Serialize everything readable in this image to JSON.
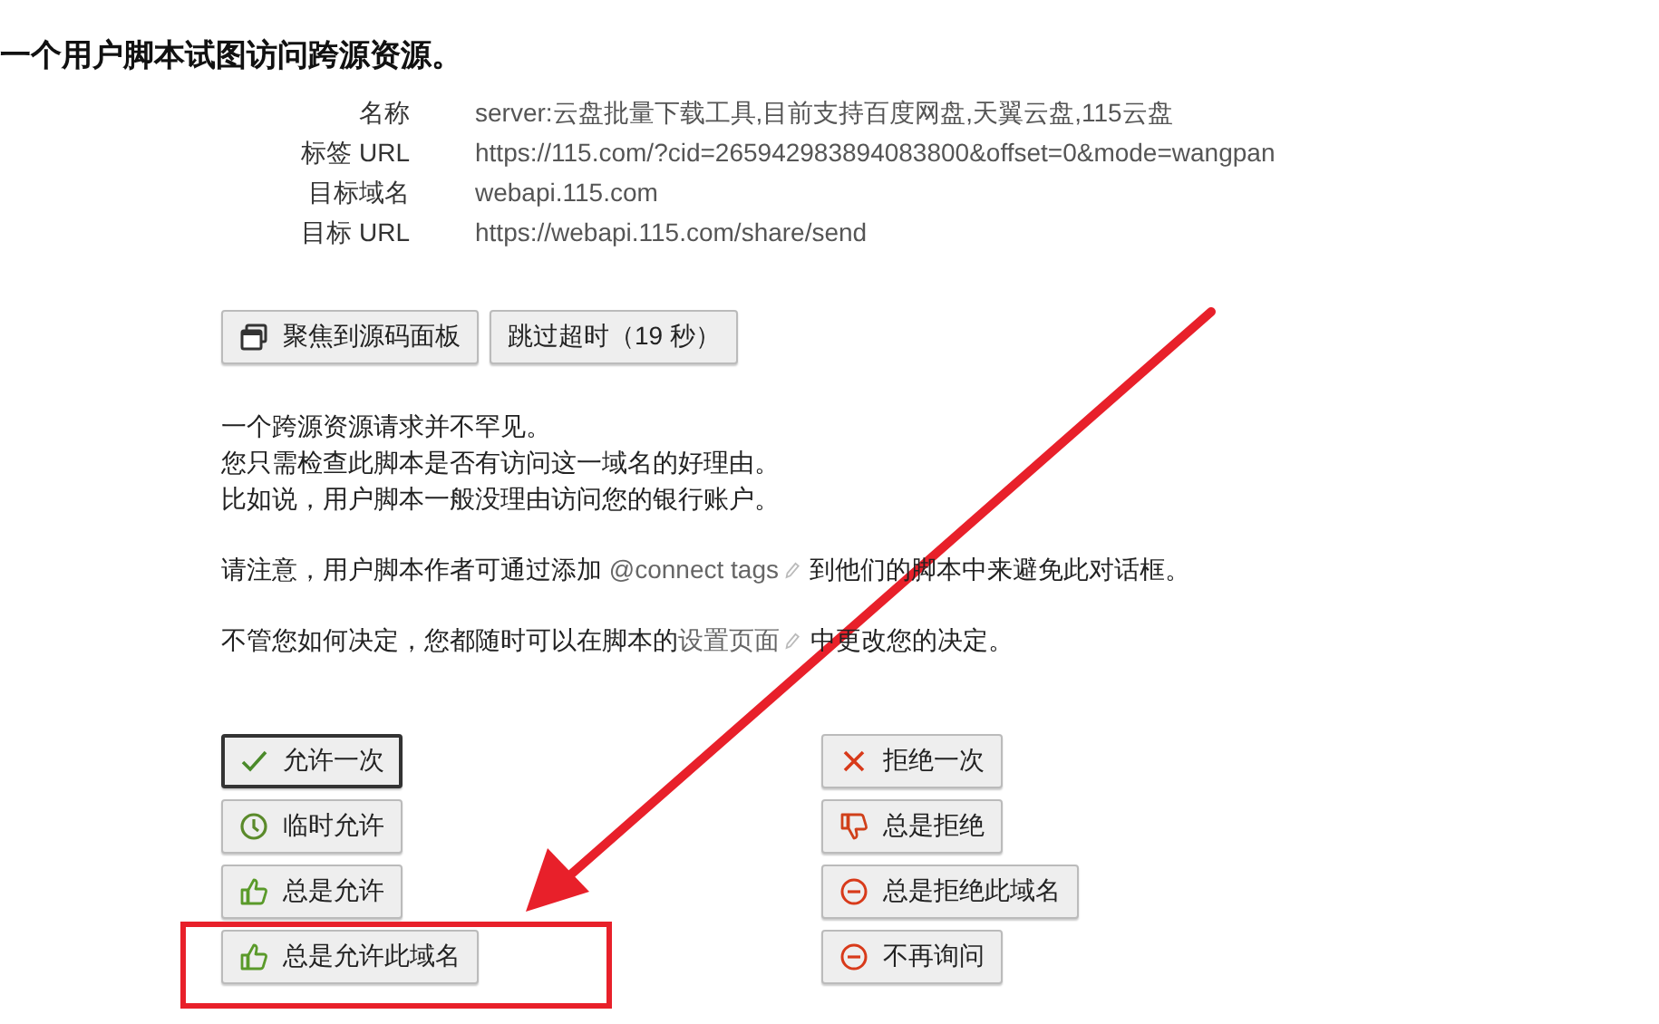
{
  "heading": "一个用户脚本试图访问跨源资源。",
  "details": [
    {
      "label": "名称",
      "value": "server:云盘批量下载工具,目前支持百度网盘,天翼云盘,115云盘"
    },
    {
      "label": "标签 URL",
      "value": "https://115.com/?cid=265942983894083800&offset=0&mode=wangpan"
    },
    {
      "label": "目标域名",
      "value": "webapi.115.com"
    },
    {
      "label": "目标 URL",
      "value": "https://webapi.115.com/share/send"
    }
  ],
  "top_buttons": [
    {
      "label": "聚焦到源码面板",
      "kind": "window"
    },
    {
      "label": "跳过超时（19 秒）",
      "kind": "plain"
    }
  ],
  "paragraphs": [
    {
      "lines": [
        [
          {
            "kind": "text",
            "text": "一个跨源资源请求并不罕见。"
          }
        ],
        [
          {
            "kind": "text",
            "text": "您只需检查此脚本是否有访问这一域名的好理由。"
          }
        ],
        [
          {
            "kind": "text",
            "text": "比如说，用户脚本一般没理由访问您的银行账户。"
          }
        ]
      ]
    },
    {
      "lines": [
        [
          {
            "kind": "text",
            "text": "请注意，用户脚本作者可通过添加 "
          },
          {
            "kind": "link",
            "text": "@connect tags"
          },
          {
            "kind": "text",
            "text": " 到他们的脚本中来避免此对话框。"
          }
        ]
      ]
    },
    {
      "lines": [
        [
          {
            "kind": "text",
            "text": "不管您如何决定，您都随时可以在脚本的"
          },
          {
            "kind": "link",
            "text": "设置页面"
          },
          {
            "kind": "text",
            "text": " 中更改您的决定。"
          }
        ]
      ]
    }
  ],
  "allow_buttons": [
    {
      "label": "允许一次",
      "kind": "check",
      "focused": true
    },
    {
      "label": "临时允许",
      "kind": "clock",
      "focused": false
    },
    {
      "label": "总是允许",
      "kind": "like",
      "focused": false
    },
    {
      "label": "总是允许此域名",
      "kind": "like",
      "focused": false
    }
  ],
  "deny_buttons": [
    {
      "label": "拒绝一次",
      "kind": "cross",
      "focused": false
    },
    {
      "label": "总是拒绝",
      "kind": "dislike",
      "focused": false
    },
    {
      "label": "总是拒绝此域名",
      "kind": "block",
      "focused": false
    },
    {
      "label": "不再询问",
      "kind": "block",
      "focused": false
    }
  ]
}
